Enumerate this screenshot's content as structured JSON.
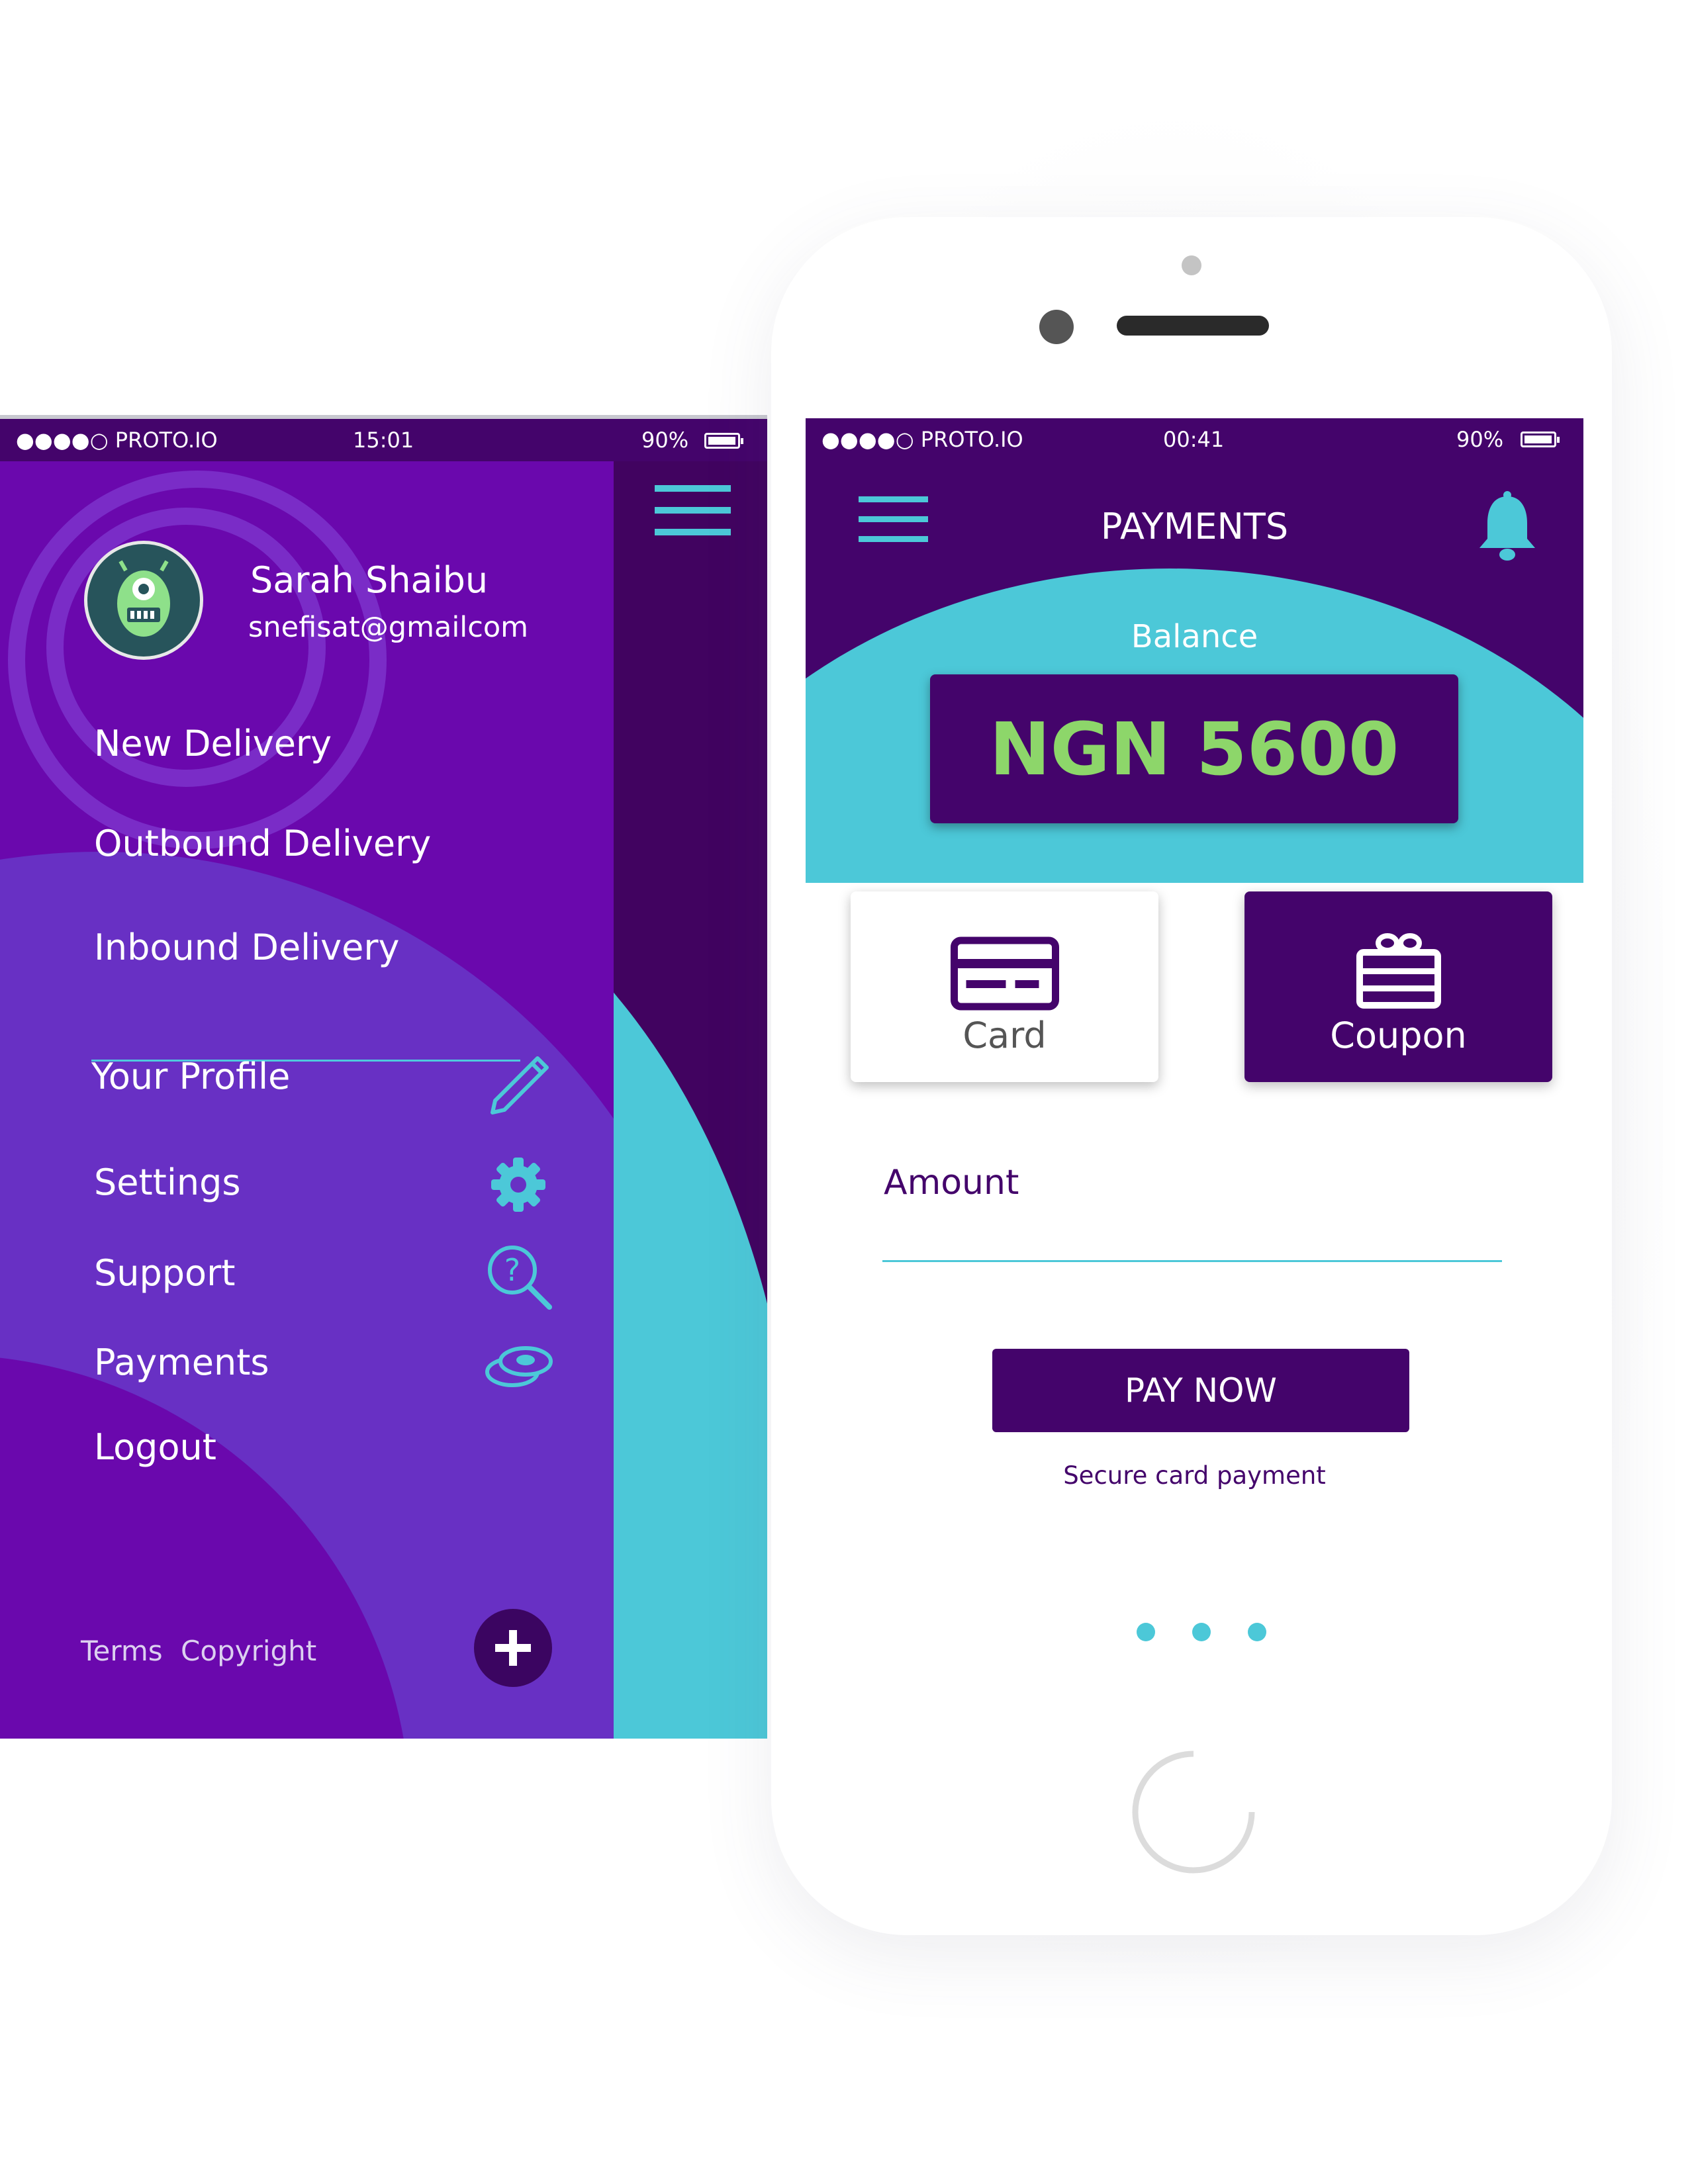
{
  "left_screen": {
    "status": {
      "carrier": "●●●●○ PROTO.IO",
      "time": "15:01",
      "battery": "90%"
    },
    "user": {
      "name": "Sarah Shaibu",
      "email": "snefisat@gmailcom"
    },
    "menu": {
      "new_delivery": "New Delivery",
      "outbound_delivery": "Outbound Delivery",
      "inbound_delivery": "Inbound Delivery",
      "your_profile": "Your Profile",
      "settings": "Settings",
      "support": "Support",
      "payments": "Payments",
      "logout": "Logout"
    },
    "footer": {
      "terms": "Terms",
      "copyright": "Copyright"
    }
  },
  "right_screen": {
    "status": {
      "carrier": "●●●●○ PROTO.IO",
      "time": "00:41",
      "battery": "90%"
    },
    "title": "PAYMENTS",
    "balance_label": "Balance",
    "balance_value": "NGN 5600",
    "methods": {
      "card": "Card",
      "coupon": "Coupon"
    },
    "amount_label": "Amount",
    "amount_value": "",
    "pay_button": "PAY NOW",
    "secure_note": "Secure card payment",
    "page_dots": 3
  },
  "colors": {
    "purple_dark": "#44046b",
    "purple_menu": "#6a08ad",
    "purple_light": "#6830c4",
    "teal": "#4cc8d8",
    "green_balance": "#8dd66a"
  },
  "icons": [
    "hamburger-icon",
    "bell-icon",
    "pencil-icon",
    "gear-icon",
    "support-search-icon",
    "coins-icon",
    "plus-icon",
    "credit-card-icon",
    "gift-icon",
    "battery-icon",
    "avatar-monster"
  ]
}
